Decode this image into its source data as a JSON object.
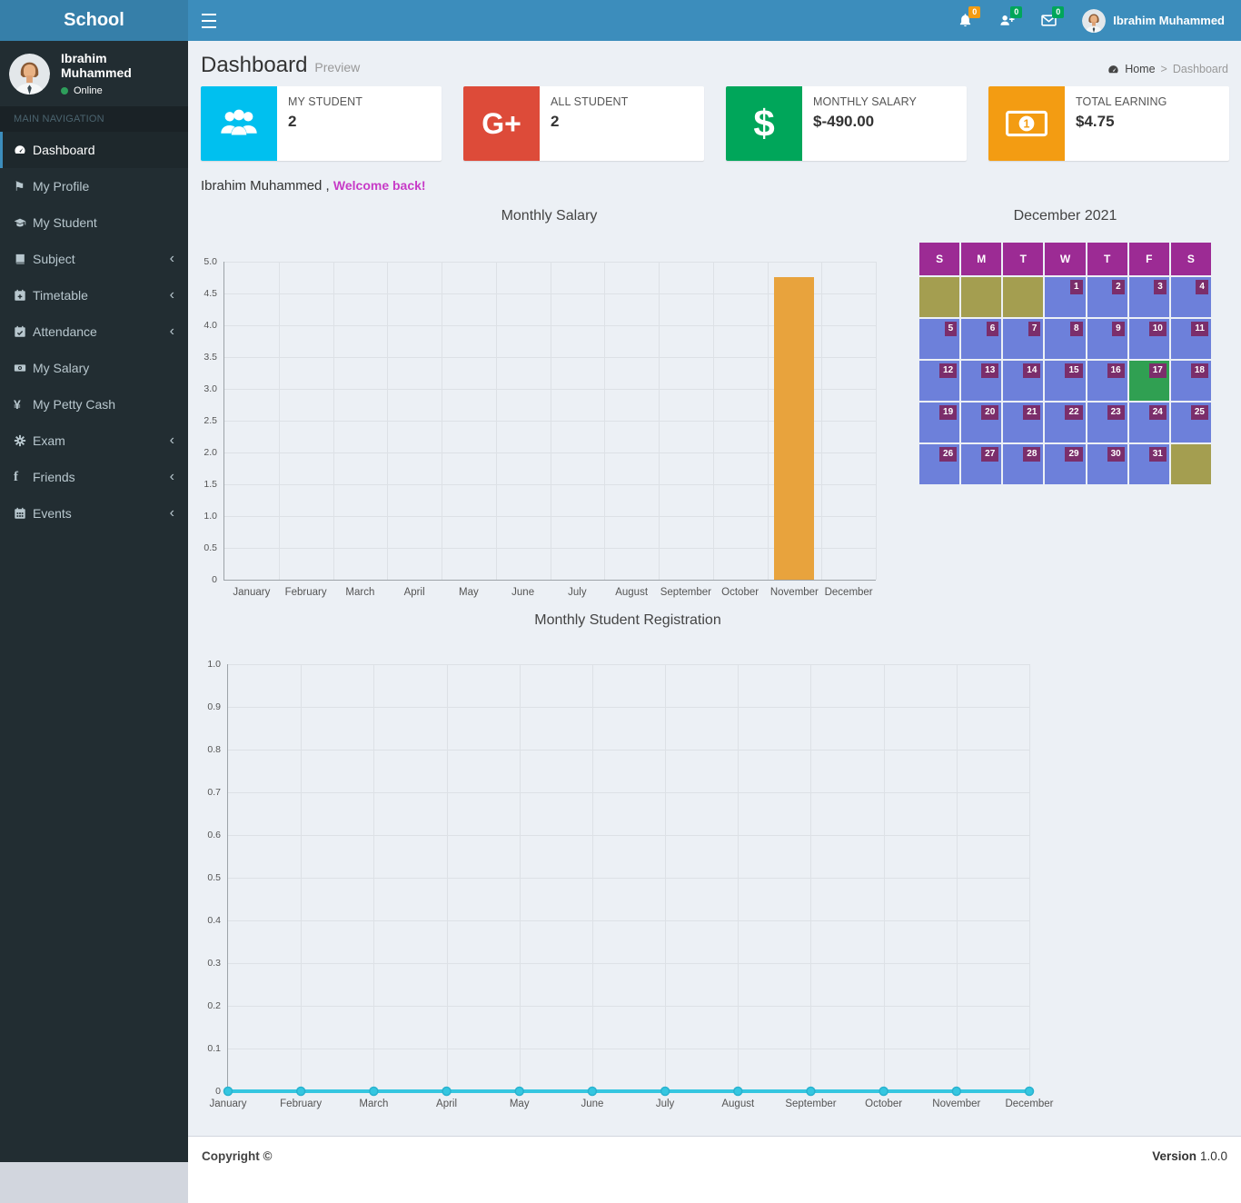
{
  "navbar": {
    "brand": "School",
    "user_name": "Ibrahim Muhammed",
    "notifications": [
      {
        "icon": "bell-icon",
        "count": "0",
        "badge_color": "#f39c12"
      },
      {
        "icon": "user-plus-icon",
        "count": "0",
        "badge_color": "#00a65a"
      },
      {
        "icon": "envelope-icon",
        "count": "0",
        "badge_color": "#00a65a"
      }
    ]
  },
  "sidebar": {
    "user": {
      "name": "Ibrahim Muhammed",
      "status": "Online"
    },
    "nav_label": "MAIN NAVIGATION",
    "items": [
      {
        "label": "Dashboard",
        "icon": "dashboard-icon",
        "active": true
      },
      {
        "label": "My Profile",
        "icon": "flag-icon"
      },
      {
        "label": "My Student",
        "icon": "graduation-cap-icon"
      },
      {
        "label": "Subject",
        "icon": "book-icon",
        "expandable": true
      },
      {
        "label": "Timetable",
        "icon": "calendar-plus-icon",
        "expandable": true
      },
      {
        "label": "Attendance",
        "icon": "calendar-check-icon",
        "expandable": true
      },
      {
        "label": "My Salary",
        "icon": "money-icon"
      },
      {
        "label": "My Petty Cash",
        "icon": "yen-icon"
      },
      {
        "label": "Exam",
        "icon": "cog-icon",
        "expandable": true
      },
      {
        "label": "Friends",
        "icon": "facebook-icon",
        "expandable": true
      },
      {
        "label": "Events",
        "icon": "calendar-icon",
        "expandable": true
      }
    ]
  },
  "header": {
    "title": "Dashboard",
    "subtitle": "Preview",
    "breadcrumb": {
      "home": "Home",
      "separator": ">",
      "current": "Dashboard"
    }
  },
  "info_boxes": [
    {
      "label": "MY STUDENT",
      "value": "2",
      "color": "#00c0ef",
      "icon": "users-icon"
    },
    {
      "label": "ALL STUDENT",
      "value": "2",
      "color": "#dd4b39",
      "icon": "google-plus-icon",
      "glyph": "G+"
    },
    {
      "label": "MONTHLY SALARY",
      "value": "$-490.00",
      "color": "#00a65a",
      "icon": "dollar-icon",
      "glyph": "$"
    },
    {
      "label": "TOTAL EARNING",
      "value": "$4.75",
      "color": "#f39c12",
      "icon": "money-bill-icon"
    }
  ],
  "welcome": {
    "prefix": "Ibrahim Muhammed ,",
    "highlight": "Welcome back!",
    "highlight_color": "#c73bc7"
  },
  "chart_data": [
    {
      "type": "bar",
      "title": "Monthly Salary",
      "categories": [
        "January",
        "February",
        "March",
        "April",
        "May",
        "June",
        "July",
        "August",
        "September",
        "October",
        "November",
        "December"
      ],
      "values": [
        0,
        0,
        0,
        0,
        0,
        0,
        0,
        0,
        0,
        0,
        4.75,
        0
      ],
      "ylim": [
        0,
        5
      ],
      "ytick_labels": [
        "0",
        "0.5",
        "1.0",
        "1.5",
        "2.0",
        "2.5",
        "3.0",
        "3.5",
        "4.0",
        "4.5",
        "5.0"
      ],
      "xlabel": "",
      "ylabel": "",
      "bar_color": "#e8a33d",
      "grid": true,
      "legend": "none"
    },
    {
      "type": "line",
      "title": "Monthly Student Registration",
      "categories": [
        "January",
        "February",
        "March",
        "April",
        "May",
        "June",
        "July",
        "August",
        "September",
        "October",
        "November",
        "December"
      ],
      "values": [
        0,
        0,
        0,
        0,
        0,
        0,
        0,
        0,
        0,
        0,
        0,
        0
      ],
      "ylim": [
        0,
        1
      ],
      "ytick_labels": [
        "0",
        "0.1",
        "0.2",
        "0.3",
        "0.4",
        "0.5",
        "0.6",
        "0.7",
        "0.8",
        "0.9",
        "1.0"
      ],
      "xlabel": "",
      "ylabel": "",
      "line_color": "#35c6e0",
      "point_stroke": "#29b2cf",
      "grid": true,
      "legend": "none"
    }
  ],
  "calendar": {
    "title": "December 2021",
    "day_headers": [
      "S",
      "M",
      "T",
      "W",
      "T",
      "F",
      "S"
    ],
    "weeks": [
      [
        {
          "type": "blank"
        },
        {
          "type": "blank"
        },
        {
          "type": "blank"
        },
        {
          "type": "day",
          "day": "1"
        },
        {
          "type": "day",
          "day": "2"
        },
        {
          "type": "day",
          "day": "3"
        },
        {
          "type": "day",
          "day": "4"
        }
      ],
      [
        {
          "type": "day",
          "day": "5"
        },
        {
          "type": "day",
          "day": "6"
        },
        {
          "type": "day",
          "day": "7"
        },
        {
          "type": "day",
          "day": "8"
        },
        {
          "type": "day",
          "day": "9"
        },
        {
          "type": "day",
          "day": "10"
        },
        {
          "type": "day",
          "day": "11"
        }
      ],
      [
        {
          "type": "day",
          "day": "12"
        },
        {
          "type": "day",
          "day": "13"
        },
        {
          "type": "day",
          "day": "14"
        },
        {
          "type": "day",
          "day": "15"
        },
        {
          "type": "day",
          "day": "16"
        },
        {
          "type": "today",
          "day": "17"
        },
        {
          "type": "day",
          "day": "18"
        }
      ],
      [
        {
          "type": "day",
          "day": "19"
        },
        {
          "type": "day",
          "day": "20"
        },
        {
          "type": "day",
          "day": "21"
        },
        {
          "type": "day",
          "day": "22"
        },
        {
          "type": "day",
          "day": "23"
        },
        {
          "type": "day",
          "day": "24"
        },
        {
          "type": "day",
          "day": "25"
        }
      ],
      [
        {
          "type": "day",
          "day": "26"
        },
        {
          "type": "day",
          "day": "27"
        },
        {
          "type": "day",
          "day": "28"
        },
        {
          "type": "day",
          "day": "29"
        },
        {
          "type": "day",
          "day": "30"
        },
        {
          "type": "day",
          "day": "31"
        },
        {
          "type": "blank"
        }
      ]
    ],
    "colors": {
      "header": "#9c2b94",
      "day": "#6d80da",
      "blank": "#a49e50",
      "today": "#30a052",
      "badge": "#7b2e6b"
    }
  },
  "footer": {
    "copyright": "Copyright ©",
    "version_label": "Version",
    "version_number": "1.0.0"
  }
}
